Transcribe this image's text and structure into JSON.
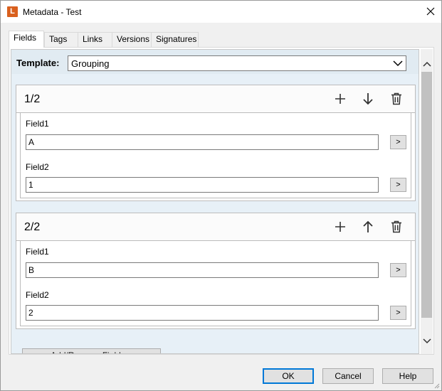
{
  "window": {
    "title": "Metadata - Test",
    "app_icon_letter": "L"
  },
  "tabs": [
    {
      "label": "Fields",
      "active": true
    },
    {
      "label": "Tags"
    },
    {
      "label": "Links"
    },
    {
      "label": "Versions"
    },
    {
      "label": "Signatures"
    }
  ],
  "template": {
    "label": "Template:",
    "value": "Grouping"
  },
  "groups": [
    {
      "title": "1/2",
      "fields": [
        {
          "label": "Field1",
          "value": "A",
          "button": ">"
        },
        {
          "label": "Field2",
          "value": "1",
          "button": ">"
        }
      ]
    },
    {
      "title": "2/2",
      "fields": [
        {
          "label": "Field1",
          "value": "B",
          "button": ">"
        },
        {
          "label": "Field2",
          "value": "2",
          "button": ">"
        }
      ]
    }
  ],
  "add_remove_label": "Add/Remove Fields...",
  "buttons": {
    "ok": "OK",
    "cancel": "Cancel",
    "help": "Help"
  },
  "colors": {
    "accent": "#0078d7",
    "app_icon": "#d9601e",
    "pane_bg": "#e7f0f7"
  }
}
